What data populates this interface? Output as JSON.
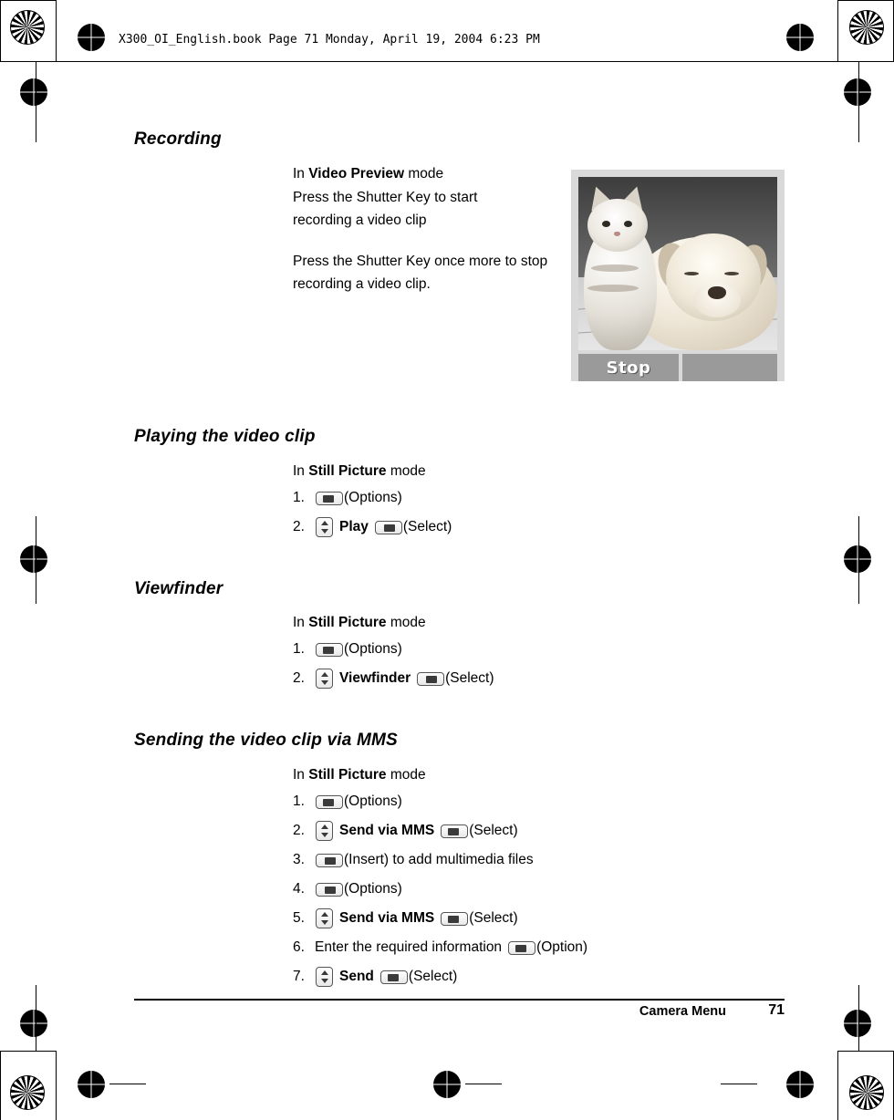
{
  "header": {
    "file_line": "X300_OI_English.book  Page 71  Monday, April 19, 2004  6:23 PM"
  },
  "sections": [
    {
      "id": "recording",
      "title": "Recording",
      "intro_prefix": "In ",
      "intro_bold": "Video Preview",
      "intro_suffix": " mode",
      "paragraph1": "Press the Shutter Key to start recording a video clip",
      "paragraph2": "Press the Shutter Key once more to stop recording a video clip."
    },
    {
      "id": "playing",
      "title": "Playing the video clip",
      "intro_prefix": "In ",
      "intro_bold": "Still Picture",
      "intro_suffix": " mode",
      "steps": [
        {
          "num": "1.",
          "keys": [
            "softkey-right"
          ],
          "text": "(Options)"
        },
        {
          "num": "2.",
          "keys": [
            "nav-updown"
          ],
          "bold": "Play",
          "keys2": [
            "softkey-left"
          ],
          "text2": "(Select)"
        }
      ]
    },
    {
      "id": "viewfinder",
      "title": "Viewfinder",
      "intro_prefix": "In ",
      "intro_bold": "Still Picture",
      "intro_suffix": " mode",
      "steps": [
        {
          "num": "1.",
          "keys": [
            "softkey-right"
          ],
          "text": "(Options)"
        },
        {
          "num": "2.",
          "keys": [
            "nav-updown"
          ],
          "bold": "Viewfinder",
          "keys2": [
            "softkey-left"
          ],
          "text2": "(Select)"
        }
      ]
    },
    {
      "id": "sending",
      "title": "Sending the video clip via MMS",
      "intro_prefix": "In ",
      "intro_bold": "Still Picture",
      "intro_suffix": " mode",
      "steps": [
        {
          "num": "1.",
          "keys": [
            "softkey-right"
          ],
          "text": "(Options)"
        },
        {
          "num": "2.",
          "keys": [
            "nav-updown"
          ],
          "bold": "Send via MMS",
          "keys2": [
            "softkey-right"
          ],
          "text2": "(Select)"
        },
        {
          "num": "3.",
          "keys": [
            "softkey-left"
          ],
          "text": "(Insert) to add multimedia files"
        },
        {
          "num": "4.",
          "keys": [
            "softkey-left"
          ],
          "text": "(Options)"
        },
        {
          "num": "5.",
          "keys": [
            "nav-updown"
          ],
          "bold": "Send via MMS",
          "keys2": [
            "softkey-right"
          ],
          "text2": "(Select)"
        },
        {
          "num": "6.",
          "plain": "Enter the required information",
          "keys2": [
            "softkey-right"
          ],
          "text2": "(Option)"
        },
        {
          "num": "7.",
          "keys": [
            "nav-updown"
          ],
          "bold": "Send",
          "keys2": [
            "softkey-right"
          ],
          "text2": "(Select)"
        }
      ]
    }
  ],
  "photo": {
    "alt": "kitten and puppy photo in camera preview",
    "softkey_left_label": "Stop",
    "softkey_right_label": ""
  },
  "footer": {
    "chapter": "Camera Menu",
    "page_number": "71"
  }
}
